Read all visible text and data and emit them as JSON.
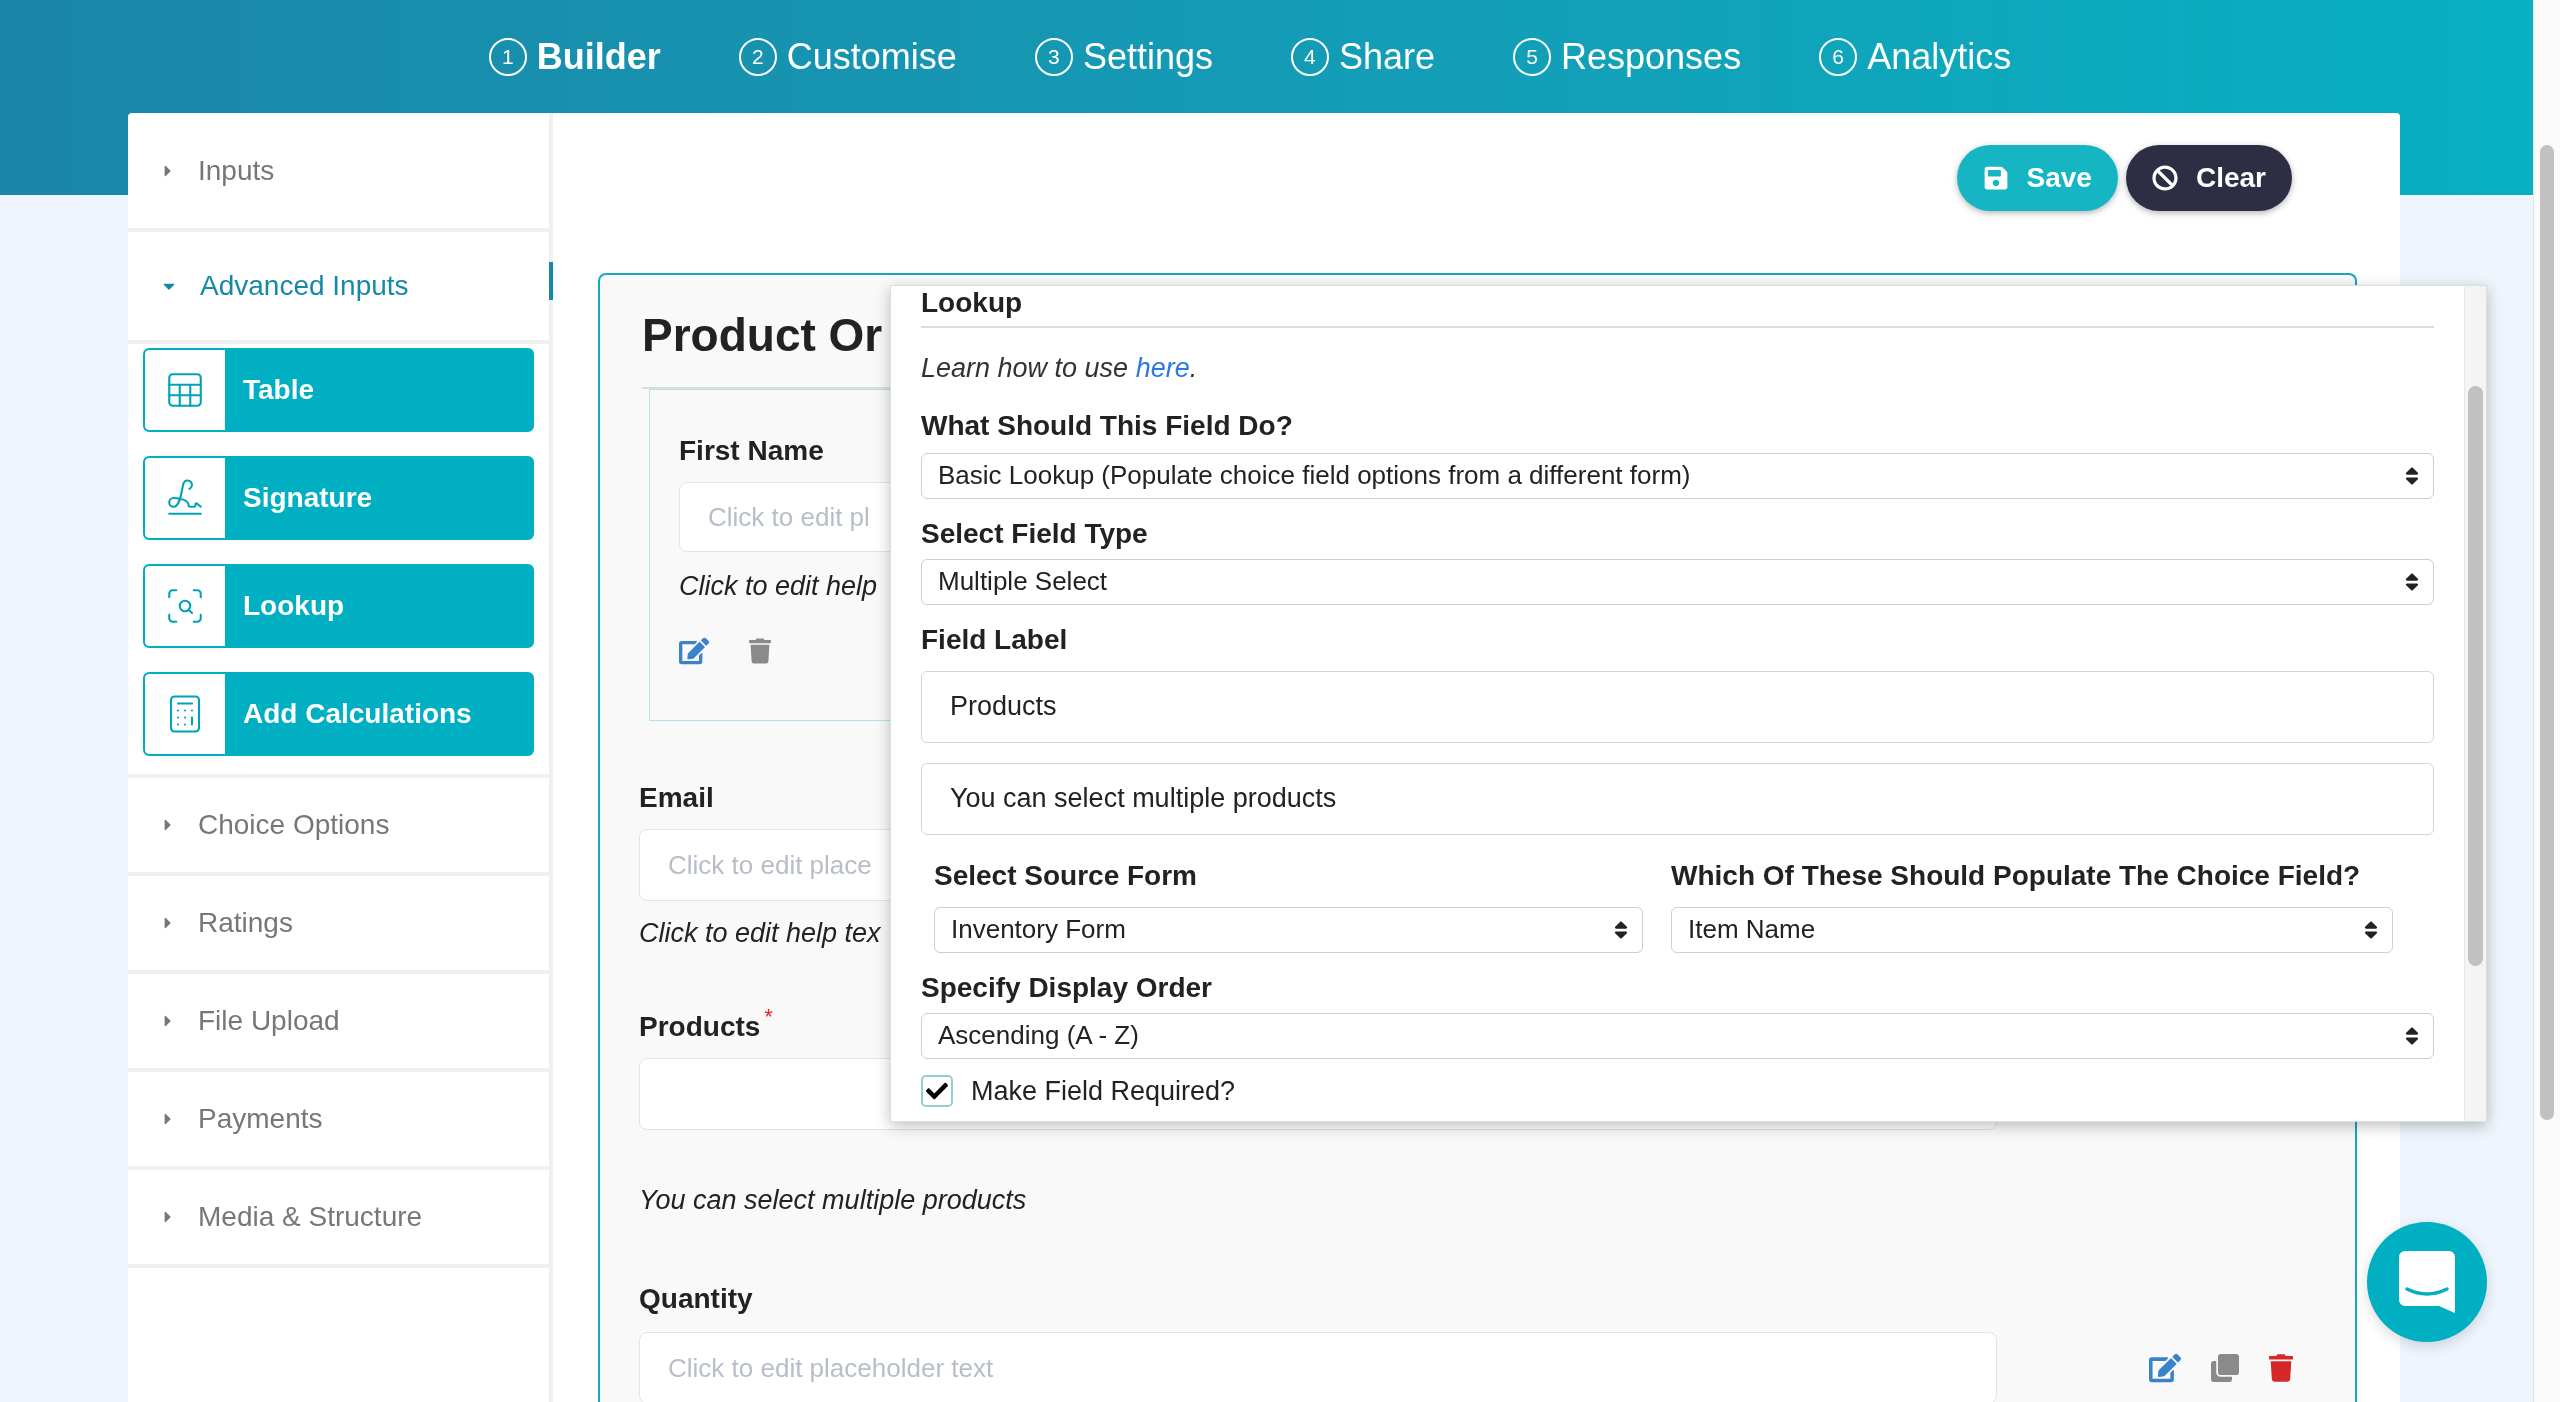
{
  "tabs": [
    {
      "number": "1",
      "label": "Builder",
      "selected": true
    },
    {
      "number": "2",
      "label": "Customise",
      "selected": false
    },
    {
      "number": "3",
      "label": "Settings",
      "selected": false
    },
    {
      "number": "4",
      "label": "Share",
      "selected": false
    },
    {
      "number": "5",
      "label": "Responses",
      "selected": false
    },
    {
      "number": "6",
      "label": "Analytics",
      "selected": false
    }
  ],
  "actions": {
    "save": "Save",
    "clear": "Clear"
  },
  "sidebar": {
    "sections": [
      {
        "label": "Inputs",
        "expanded": false
      },
      {
        "label": "Advanced Inputs",
        "expanded": true,
        "items": [
          "Table",
          "Signature",
          "Lookup",
          "Add Calculations"
        ]
      },
      {
        "label": "Choice Options",
        "expanded": false
      },
      {
        "label": "Ratings",
        "expanded": false
      },
      {
        "label": "File Upload",
        "expanded": false
      },
      {
        "label": "Payments",
        "expanded": false
      },
      {
        "label": "Media & Structure",
        "expanded": false
      }
    ]
  },
  "form": {
    "title": "Product Or",
    "first_name": {
      "label": "First Name",
      "placeholder": "Click to edit pl",
      "help": "Click to edit help"
    },
    "email": {
      "label": "Email",
      "placeholder": "Click to edit place",
      "help": "Click to edit help tex"
    },
    "products": {
      "label": "Products",
      "required_mark": "*",
      "help": "You can select multiple products"
    },
    "quantity": {
      "label": "Quantity",
      "placeholder": "Click to edit placeholder text"
    }
  },
  "lookup_panel": {
    "title": "Lookup",
    "intro": "Learn how to use",
    "link": "here",
    "intro_end": ".",
    "purpose": {
      "label": "What Should This Field Do?",
      "value": "Basic Lookup (Populate choice field options from a different form)"
    },
    "field_type": {
      "label": "Select Field Type",
      "value": "Multiple Select"
    },
    "field_label": {
      "label": "Field Label",
      "value": "Products"
    },
    "help_text": {
      "value": "You can select multiple products"
    },
    "source_form": {
      "label": "Select Source Form",
      "value": "Inventory Form"
    },
    "populate_field": {
      "label": "Which Of These Should Populate The Choice Field?",
      "value": "Item Name"
    },
    "display_order": {
      "label": "Specify Display Order",
      "value": "Ascending (A - Z)"
    },
    "required": {
      "label": "Make Field Required?",
      "checked": true
    }
  }
}
